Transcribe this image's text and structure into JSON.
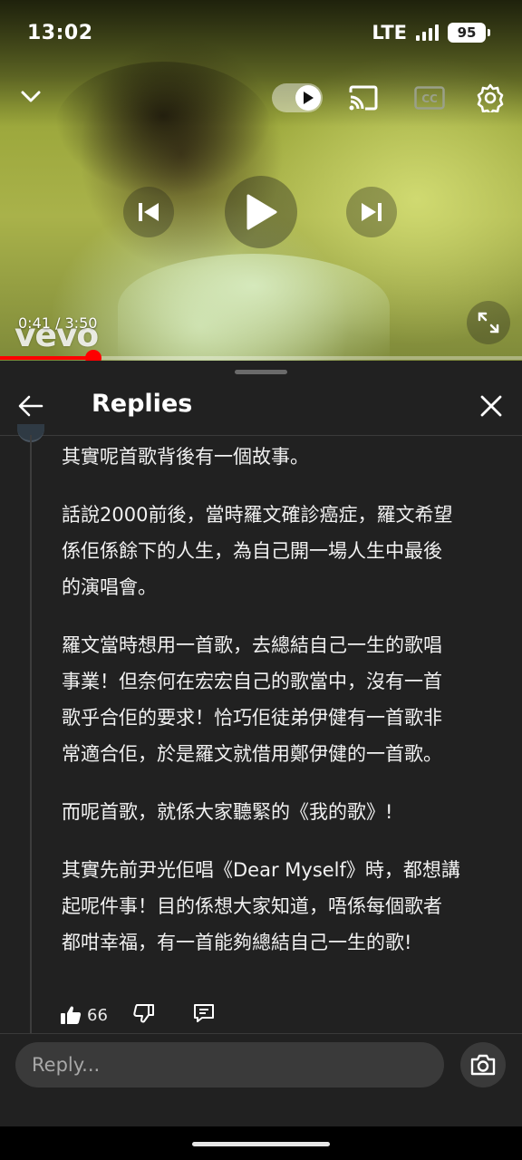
{
  "status_bar": {
    "time": "13:02",
    "network": "LTE",
    "battery": "95"
  },
  "player": {
    "time_current": "0:41",
    "time_separator": " / ",
    "time_total": "3:50",
    "watermark": "vevo",
    "progress_fraction": 0.178,
    "accent_color": "#ff0000",
    "icons": [
      "chevron-down-icon",
      "autoplay-toggle-icon",
      "cast-icon",
      "cc-icon",
      "settings-icon",
      "previous-icon",
      "play-icon",
      "next-icon",
      "fullscreen-icon"
    ]
  },
  "replies_panel": {
    "title": "Replies",
    "comment": {
      "paragraphs": [
        "其實呢首歌背後有一個故事。",
        "話說2000前後，當時羅文確診癌症，羅文希望\n係佢係餘下的人生，為自己開一場人生中最後\n的演唱會。",
        "羅文當時想用一首歌，去總結自己一生的歌唱\n事業！但奈何在宏宏自己的歌當中，沒有一首\n歌乎合佢的要求！恰巧佢徒弟伊健有一首歌非\n常適合佢，於是羅文就借用鄭伊健的一首歌。",
        "而呢首歌，就係大家聽緊的《我的歌》!",
        "其實先前尹光佢唱《Dear Myself》時，都想講\n起呢件事！目的係想大家知道，唔係每個歌者\n都咁幸福，有一首能夠總結自己一生的歌!"
      ],
      "like_count": "66"
    },
    "reply_input": {
      "placeholder": "Reply..."
    }
  }
}
